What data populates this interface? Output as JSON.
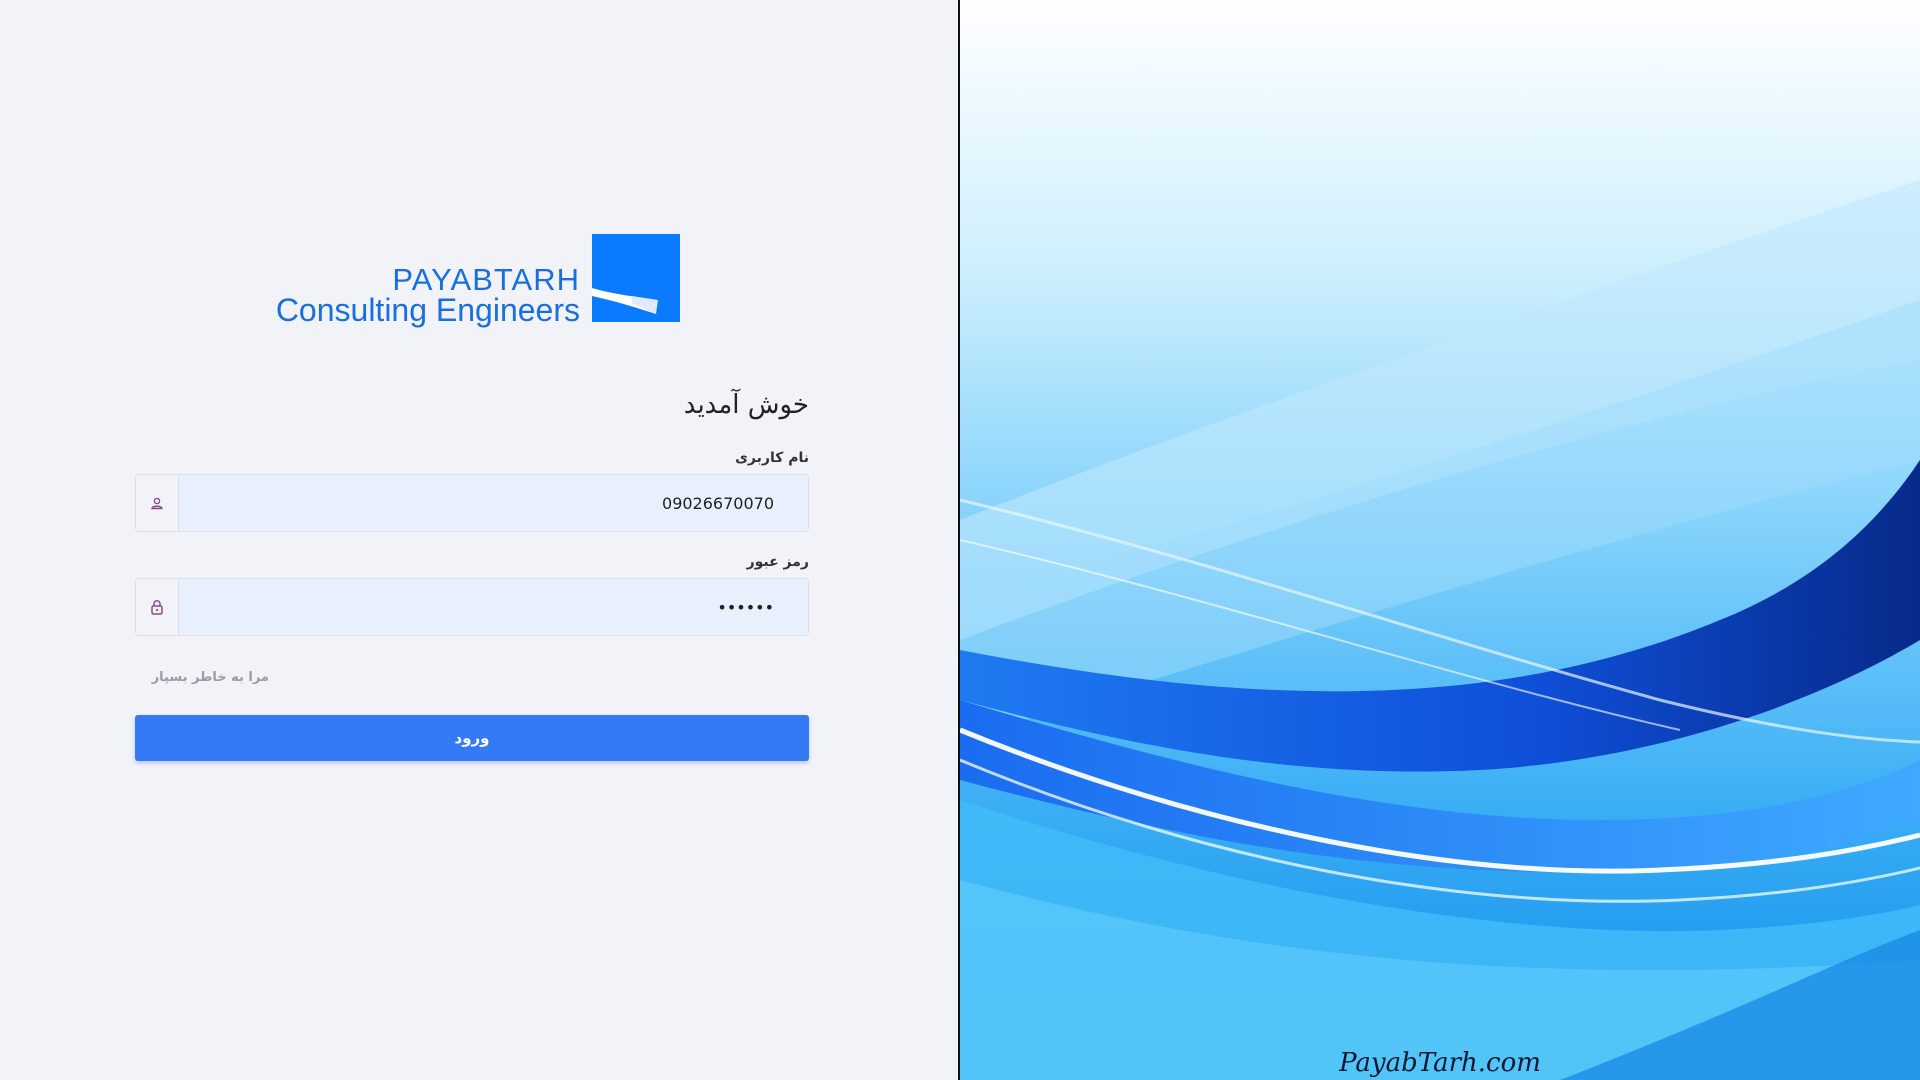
{
  "logo": {
    "line1": "PAYABTARH",
    "line2": "Consulting Engineers",
    "accent_color": "#0a7bff"
  },
  "login": {
    "welcome": "خوش آمدید",
    "username_label": "نام کاربری",
    "username_value": "09026670070",
    "username_icon": "user-icon",
    "password_label": "رمز عبور",
    "password_value": "••••••",
    "password_icon": "lock-icon",
    "remember_label": "مرا به خاطر بسپار",
    "submit_label": "ورود",
    "button_color": "#3479f6"
  },
  "background": {
    "site_url": "PayabTarh.com"
  }
}
